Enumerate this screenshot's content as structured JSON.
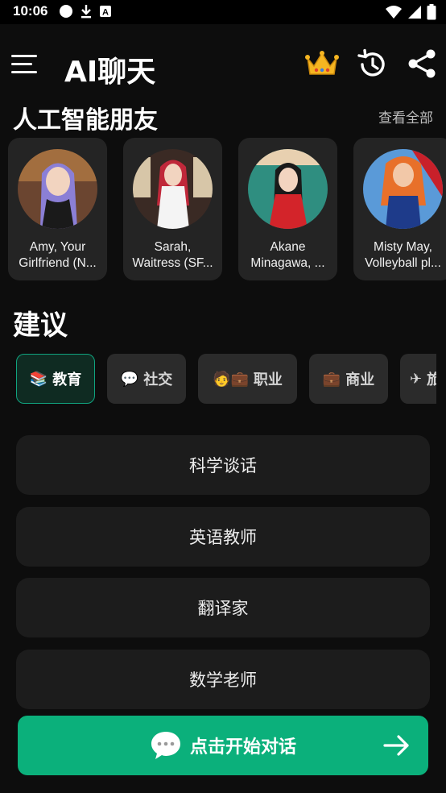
{
  "status_bar": {
    "time": "10:06",
    "left_icons": [
      "notification-dot-icon",
      "download-icon",
      "a-box-icon"
    ],
    "right_icons": [
      "wifi-icon",
      "signal-icon",
      "battery-icon"
    ]
  },
  "app_bar": {
    "title": "AI聊天",
    "icons": [
      "menu-icon",
      "crown-icon",
      "history-icon",
      "share-icon"
    ]
  },
  "friends": {
    "title": "人工智能朋友",
    "view_all": "查看全部",
    "items": [
      {
        "line1": "Amy, Your",
        "line2": "Girlfriend (N...",
        "hair": "#8b7fd6",
        "bg": "#5a3a2a"
      },
      {
        "line1": "Sarah,",
        "line2": "Waitress (SF...",
        "hair": "#c0283a",
        "bg": "#3a2a24"
      },
      {
        "line1": "Akane",
        "line2": "Minagawa, ...",
        "hair": "#1a1a1a",
        "bg": "#2f8e80"
      },
      {
        "line1": "Misty May,",
        "line2": "Volleyball pl...",
        "hair": "#e8702a",
        "bg": "#5a9ad8"
      }
    ]
  },
  "suggestions": {
    "title": "建议",
    "chips": [
      {
        "emoji": "📚",
        "label": "教育",
        "active": true
      },
      {
        "emoji": "💬",
        "label": "社交",
        "active": false
      },
      {
        "emoji": "🧑💼",
        "label": "职业",
        "active": false
      },
      {
        "emoji": "💼",
        "label": "商业",
        "active": false
      },
      {
        "emoji": "✈",
        "label": "旅",
        "active": false
      }
    ],
    "prompts": [
      "科学谈话",
      "英语教师",
      "翻译家",
      "数学老师"
    ]
  },
  "cta": {
    "label": "点击开始对话",
    "icon": "chat-bubble-icon",
    "arrow": "arrow-right-icon"
  },
  "colors": {
    "accent": "#0bb07b",
    "background": "#0d0d0d",
    "card": "#242424",
    "crown": "#f5b521"
  }
}
